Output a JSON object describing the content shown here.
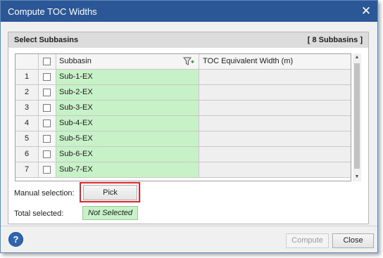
{
  "window": {
    "title": "Compute TOC Widths",
    "close_glyph": "✕"
  },
  "panel": {
    "title": "Select Subbasins",
    "count": "[ 8 Subbasins ]"
  },
  "grid": {
    "headers": {
      "name": "Subbasin",
      "toc": "TOC Equivalent Width (m)"
    },
    "rows": [
      {
        "num": "1",
        "name": "Sub-1-EX",
        "toc": ""
      },
      {
        "num": "2",
        "name": "Sub-2-EX",
        "toc": ""
      },
      {
        "num": "3",
        "name": "Sub-3-EX",
        "toc": ""
      },
      {
        "num": "4",
        "name": "Sub-4-EX",
        "toc": ""
      },
      {
        "num": "5",
        "name": "Sub-5-EX",
        "toc": ""
      },
      {
        "num": "6",
        "name": "Sub-6-EX",
        "toc": ""
      },
      {
        "num": "7",
        "name": "Sub-7-EX",
        "toc": ""
      }
    ]
  },
  "manual_selection": {
    "label": "Manual selection:",
    "button": "Pick"
  },
  "total_selected": {
    "label": "Total selected:",
    "value": "Not Selected"
  },
  "footer": {
    "help": "?",
    "compute": "Compute",
    "close": "Close"
  },
  "icons": {
    "filter": "filter-add-icon",
    "help": "help-icon",
    "close": "close-icon"
  },
  "colors": {
    "title_bar": "#2b5797",
    "selected_cell": "#c7f2c7",
    "highlight": "#e0262d"
  }
}
